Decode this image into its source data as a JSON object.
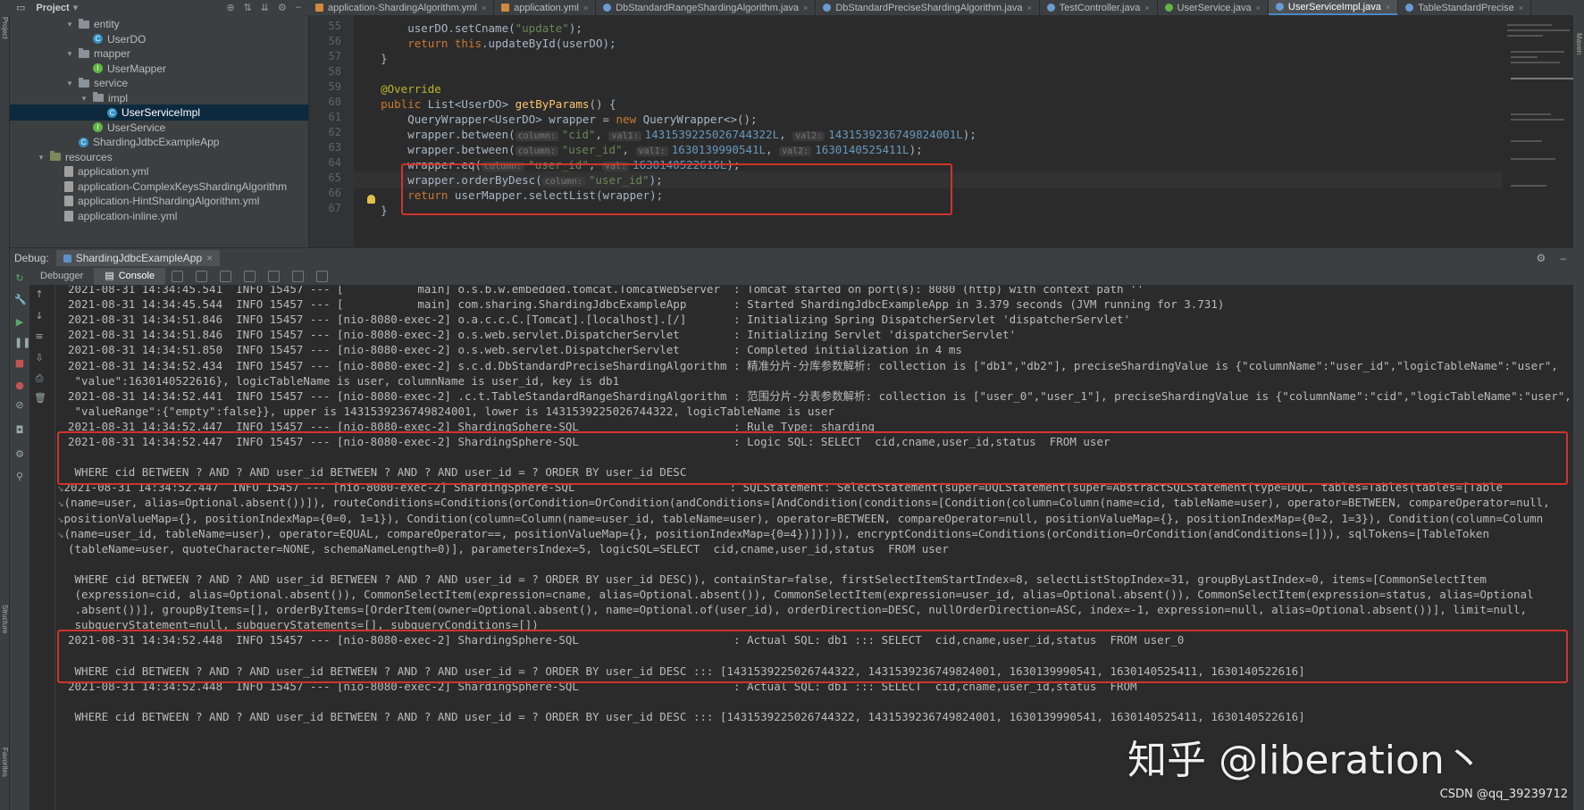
{
  "project_panel": {
    "title": "Project"
  },
  "editor_tabs": [
    {
      "label": "application-ShardingAlgorithm.yml",
      "type": "yml",
      "active": false
    },
    {
      "label": "application.yml",
      "type": "yml",
      "active": false
    },
    {
      "label": "DbStandardRangeShardingAlgorithm.java",
      "type": "class",
      "active": false
    },
    {
      "label": "DbStandardPreciseShardingAlgorithm.java",
      "type": "class",
      "active": false
    },
    {
      "label": "TestController.java",
      "type": "class",
      "active": false
    },
    {
      "label": "UserService.java",
      "type": "interface",
      "active": false
    },
    {
      "label": "UserServiceImpl.java",
      "type": "class",
      "active": true
    },
    {
      "label": "TableStandardPrecise",
      "type": "class",
      "active": false
    }
  ],
  "tree": [
    {
      "label": "entity",
      "kind": "folder",
      "depth": 4,
      "arrow": "▾"
    },
    {
      "label": "UserDO",
      "kind": "class",
      "depth": 5,
      "arrow": ""
    },
    {
      "label": "mapper",
      "kind": "folder",
      "depth": 4,
      "arrow": "▾"
    },
    {
      "label": "UserMapper",
      "kind": "interface",
      "depth": 5,
      "arrow": ""
    },
    {
      "label": "service",
      "kind": "folder",
      "depth": 4,
      "arrow": "▾"
    },
    {
      "label": "impl",
      "kind": "folder",
      "depth": 5,
      "arrow": "▾"
    },
    {
      "label": "UserServiceImpl",
      "kind": "class",
      "depth": 6,
      "arrow": "",
      "selected": true
    },
    {
      "label": "UserService",
      "kind": "interface",
      "depth": 5,
      "arrow": ""
    },
    {
      "label": "ShardingJdbcExampleApp",
      "kind": "class",
      "depth": 4,
      "arrow": ""
    },
    {
      "label": "resources",
      "kind": "resfolder",
      "depth": 2,
      "arrow": "▾"
    },
    {
      "label": "application.yml",
      "kind": "yml",
      "depth": 3,
      "arrow": ""
    },
    {
      "label": "application-ComplexKeysShardingAlgorithm",
      "kind": "yml",
      "depth": 3,
      "arrow": ""
    },
    {
      "label": "application-HintShardingAlgorithm.yml",
      "kind": "yml",
      "depth": 3,
      "arrow": ""
    },
    {
      "label": "application-inline.yml",
      "kind": "yml",
      "depth": 3,
      "arrow": ""
    }
  ],
  "code": {
    "line_numbers": [
      "55",
      "56",
      "57",
      "58",
      "59",
      "60",
      "61",
      "62",
      "63",
      "64",
      "65",
      "66",
      "67"
    ],
    "line55": {
      "pre": "        userDO.setCname(",
      "str": "\"update\"",
      "post": ");"
    },
    "line56": {
      "pre": "        ",
      "kw": "return this",
      "post": ".updateById(userDO);"
    },
    "line57": {
      "text": "    }"
    },
    "line59": {
      "text": "    @Override"
    },
    "line60": {
      "kw": "    public ",
      "type": "List<UserDO> ",
      "fn": "getByParams",
      "post": "() {"
    },
    "line61": {
      "pre": "        QueryWrapper<UserDO> wrapper = ",
      "kw": "new ",
      "post": "QueryWrapper<>();"
    },
    "line62": {
      "pre": "        wrapper.between(",
      "h1": "column:",
      "s1": "\"cid\"",
      "m1": ", ",
      "h2": "val1:",
      "n1": "1431539225026744322L",
      "m2": ", ",
      "h3": "val2:",
      "n2": "1431539236749824001L",
      "post": ");"
    },
    "line63": {
      "pre": "        wrapper.between(",
      "h1": "column:",
      "s1": "\"user_id\"",
      "m1": ", ",
      "h2": "val1:",
      "n1": "1630139990541L",
      "m2": ", ",
      "h3": "val2:",
      "n2": "1630140525411L",
      "post": ");"
    },
    "line64": {
      "pre": "        wrapper.eq(",
      "h1": "column:",
      "s1": "\"user_id\"",
      "m1": ", ",
      "h2": "val:",
      "n1": "1630140522616L",
      "post": ");"
    },
    "line65": {
      "pre": "        wrapper.orderByDesc(",
      "h1": "column:",
      "s1": "\"user_id\"",
      "post": ");"
    },
    "line66": {
      "pre": "        ",
      "kw": "return ",
      "post": "userMapper.selectList(wrapper);"
    },
    "line67": {
      "text": "    }"
    }
  },
  "debug": {
    "label": "Debug:",
    "session_tab": "ShardingJdbcExampleApp",
    "tabs": [
      "Debugger",
      "Console"
    ],
    "active_tab": "Console"
  },
  "console_lines": [
    "2021-08-31 14:34:45.541  INFO 15457 --- [           main] o.s.b.w.embedded.tomcat.TomcatWebServer  : Tomcat started on port(s): 8080 (http) with context path ''",
    "2021-08-31 14:34:45.544  INFO 15457 --- [           main] com.sharing.ShardingJdbcExampleApp       : Started ShardingJdbcExampleApp in 3.379 seconds (JVM running for 3.731)",
    "2021-08-31 14:34:51.846  INFO 15457 --- [nio-8080-exec-2] o.a.c.c.C.[Tomcat].[localhost].[/]       : Initializing Spring DispatcherServlet 'dispatcherServlet'",
    "2021-08-31 14:34:51.846  INFO 15457 --- [nio-8080-exec-2] o.s.web.servlet.DispatcherServlet        : Initializing Servlet 'dispatcherServlet'",
    "2021-08-31 14:34:51.850  INFO 15457 --- [nio-8080-exec-2] o.s.web.servlet.DispatcherServlet        : Completed initialization in 4 ms",
    "2021-08-31 14:34:52.434  INFO 15457 --- [nio-8080-exec-2] s.c.d.DbStandardPreciseShardingAlgorithm : 精准分片-分库参数解析: collection is [\"db1\",\"db2\"], preciseShardingValue is {\"columnName\":\"user_id\",\"logicTableName\":\"user\",",
    " \"value\":1630140522616}, logicTableName is user, columnName is user_id, key is db1",
    "2021-08-31 14:34:52.441  INFO 15457 --- [nio-8080-exec-2] .c.t.TableStandardRangeShardingAlgorithm : 范围分片-分表参数解析: collection is [\"user_0\",\"user_1\"], preciseShardingValue is {\"columnName\":\"cid\",\"logicTableName\":\"user\",",
    " \"valueRange\":{\"empty\":false}}, upper is 1431539236749824001, lower is 1431539225026744322, logicTableName is user",
    "2021-08-31 14:34:52.447  INFO 15457 --- [nio-8080-exec-2] ShardingSphere-SQL                       : Rule Type: sharding",
    "2021-08-31 14:34:52.447  INFO 15457 --- [nio-8080-exec-2] ShardingSphere-SQL                       : Logic SQL: SELECT  cid,cname,user_id,status  FROM user",
    "",
    " WHERE cid BETWEEN ? AND ? AND user_id BETWEEN ? AND ? AND user_id = ? ORDER BY user_id DESC",
    "2021-08-31 14:34:52.447  INFO 15457 --- [nio-8080-exec-2] ShardingSphere-SQL                       : SQLStatement: SelectStatement(super=DQLStatement(super=AbstractSQLStatement(type=DQL, tables=Tables(tables=[Table",
    "(name=user, alias=Optional.absent())]), routeConditions=Conditions(orCondition=OrCondition(andConditions=[AndCondition(conditions=[Condition(column=Column(name=cid, tableName=user), operator=BETWEEN, compareOperator=null,",
    "positionValueMap={}, positionIndexMap={0=0, 1=1}), Condition(column=Column(name=user_id, tableName=user), operator=BETWEEN, compareOperator=null, positionValueMap={}, positionIndexMap={0=2, 1=3}), Condition(column=Column",
    "(name=user_id, tableName=user), operator=EQUAL, compareOperator==, positionValueMap={}, positionIndexMap={0=4})])])), encryptConditions=Conditions(orCondition=OrCondition(andConditions=[])), sqlTokens=[TableToken",
    "(tableName=user, quoteCharacter=NONE, schemaNameLength=0)], parametersIndex=5, logicSQL=SELECT  cid,cname,user_id,status  FROM user",
    "",
    " WHERE cid BETWEEN ? AND ? AND user_id BETWEEN ? AND ? AND user_id = ? ORDER BY user_id DESC)), containStar=false, firstSelectItemStartIndex=8, selectListStopIndex=31, groupByLastIndex=0, items=[CommonSelectItem",
    " (expression=cid, alias=Optional.absent()), CommonSelectItem(expression=cname, alias=Optional.absent()), CommonSelectItem(expression=user_id, alias=Optional.absent()), CommonSelectItem(expression=status, alias=Optional",
    " .absent())], groupByItems=[], orderByItems=[OrderItem(owner=Optional.absent(), name=Optional.of(user_id), orderDirection=DESC, nullOrderDirection=ASC, index=-1, expression=null, alias=Optional.absent())], limit=null,",
    " subqueryStatement=null, subqueryStatements=[], subqueryConditions=[])",
    "2021-08-31 14:34:52.448  INFO 15457 --- [nio-8080-exec-2] ShardingSphere-SQL                       : Actual SQL: db1 ::: SELECT  cid,cname,user_id,status  FROM user_0",
    "",
    " WHERE cid BETWEEN ? AND ? AND user_id BETWEEN ? AND ? AND user_id = ? ORDER BY user_id DESC ::: [1431539225026744322, 1431539236749824001, 1630139990541, 1630140525411, 1630140522616]",
    "2021-08-31 14:34:52.448  INFO 15457 --- [nio-8080-exec-2] ShardingSphere-SQL                       : Actual SQL: db1 ::: SELECT  cid,cname,user_id,status  FROM",
    "",
    " WHERE cid BETWEEN ? AND ? AND user_id BETWEEN ? AND ? AND user_id = ? ORDER BY user_id DESC ::: [1431539225026744322, 1431539236749824001, 1630139990541, 1630140525411, 1630140522616]"
  ],
  "wrap_rows": [
    13,
    14,
    15,
    16
  ],
  "watermark": "知乎 @liberation丶",
  "credit": "CSDN @qq_39239712",
  "side_labels": {
    "left_top": "Project",
    "left_bottom": "Favorites",
    "left_mid": "Structure",
    "right_top": "Maven"
  },
  "colors": {
    "highlight_box": "#d2322d",
    "background": "#2b2b2b",
    "panel": "#3c3f41"
  }
}
